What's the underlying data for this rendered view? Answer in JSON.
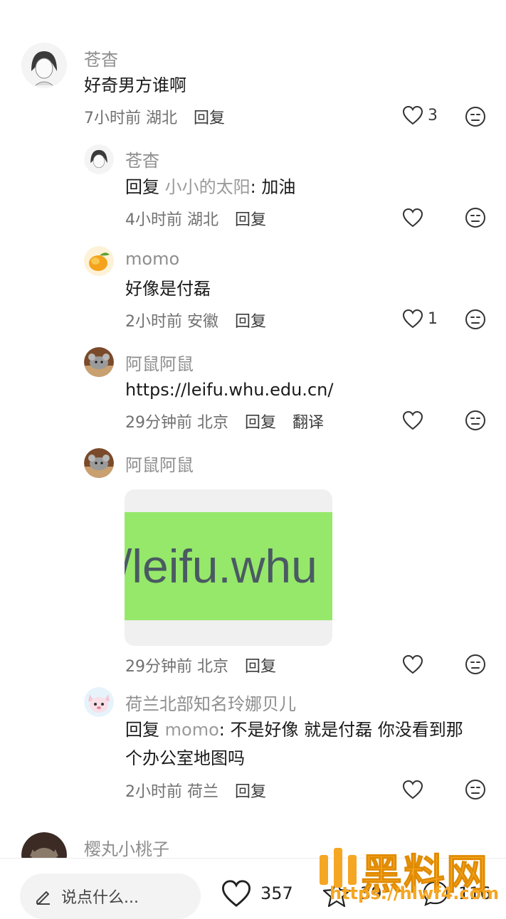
{
  "comments": [
    {
      "name": "苍杳",
      "text": "好奇男方谁啊",
      "time": "7小时前",
      "region": "湖北",
      "reply": "回复",
      "likes": "3"
    },
    {
      "name": "苍杳",
      "reply_prefix": "回复",
      "reply_to": "小小的太阳",
      "text": ": 加油",
      "time": "4小时前",
      "region": "湖北",
      "reply": "回复"
    },
    {
      "name": "momo",
      "text": "好像是付磊",
      "time": "2小时前",
      "region": "安徽",
      "reply": "回复",
      "likes": "1"
    },
    {
      "name": "阿鼠阿鼠",
      "text": "https://leifu.whu.edu.cn/",
      "time": "29分钟前",
      "region": "北京",
      "reply": "回复",
      "translate": "翻译"
    },
    {
      "name": "阿鼠阿鼠",
      "image_text": "/leifu.whu",
      "time": "29分钟前",
      "region": "北京",
      "reply": "回复"
    },
    {
      "name": "荷兰北部知名玲娜贝儿",
      "reply_prefix": "回复",
      "reply_to": "momo",
      "text_line1": ": 不是好像 就是付磊 你没看到那",
      "text_line2": "个办公室地图吗",
      "time": "2小时前",
      "region": "荷兰",
      "reply": "回复"
    },
    {
      "name": "樱丸小桃子"
    }
  ],
  "bottom_bar": {
    "input_placeholder": "说点什么...",
    "likes": "357",
    "stars": "39",
    "comments": "116"
  },
  "watermark": {
    "title": "黑料网",
    "url": "https://hlwf4.com"
  }
}
